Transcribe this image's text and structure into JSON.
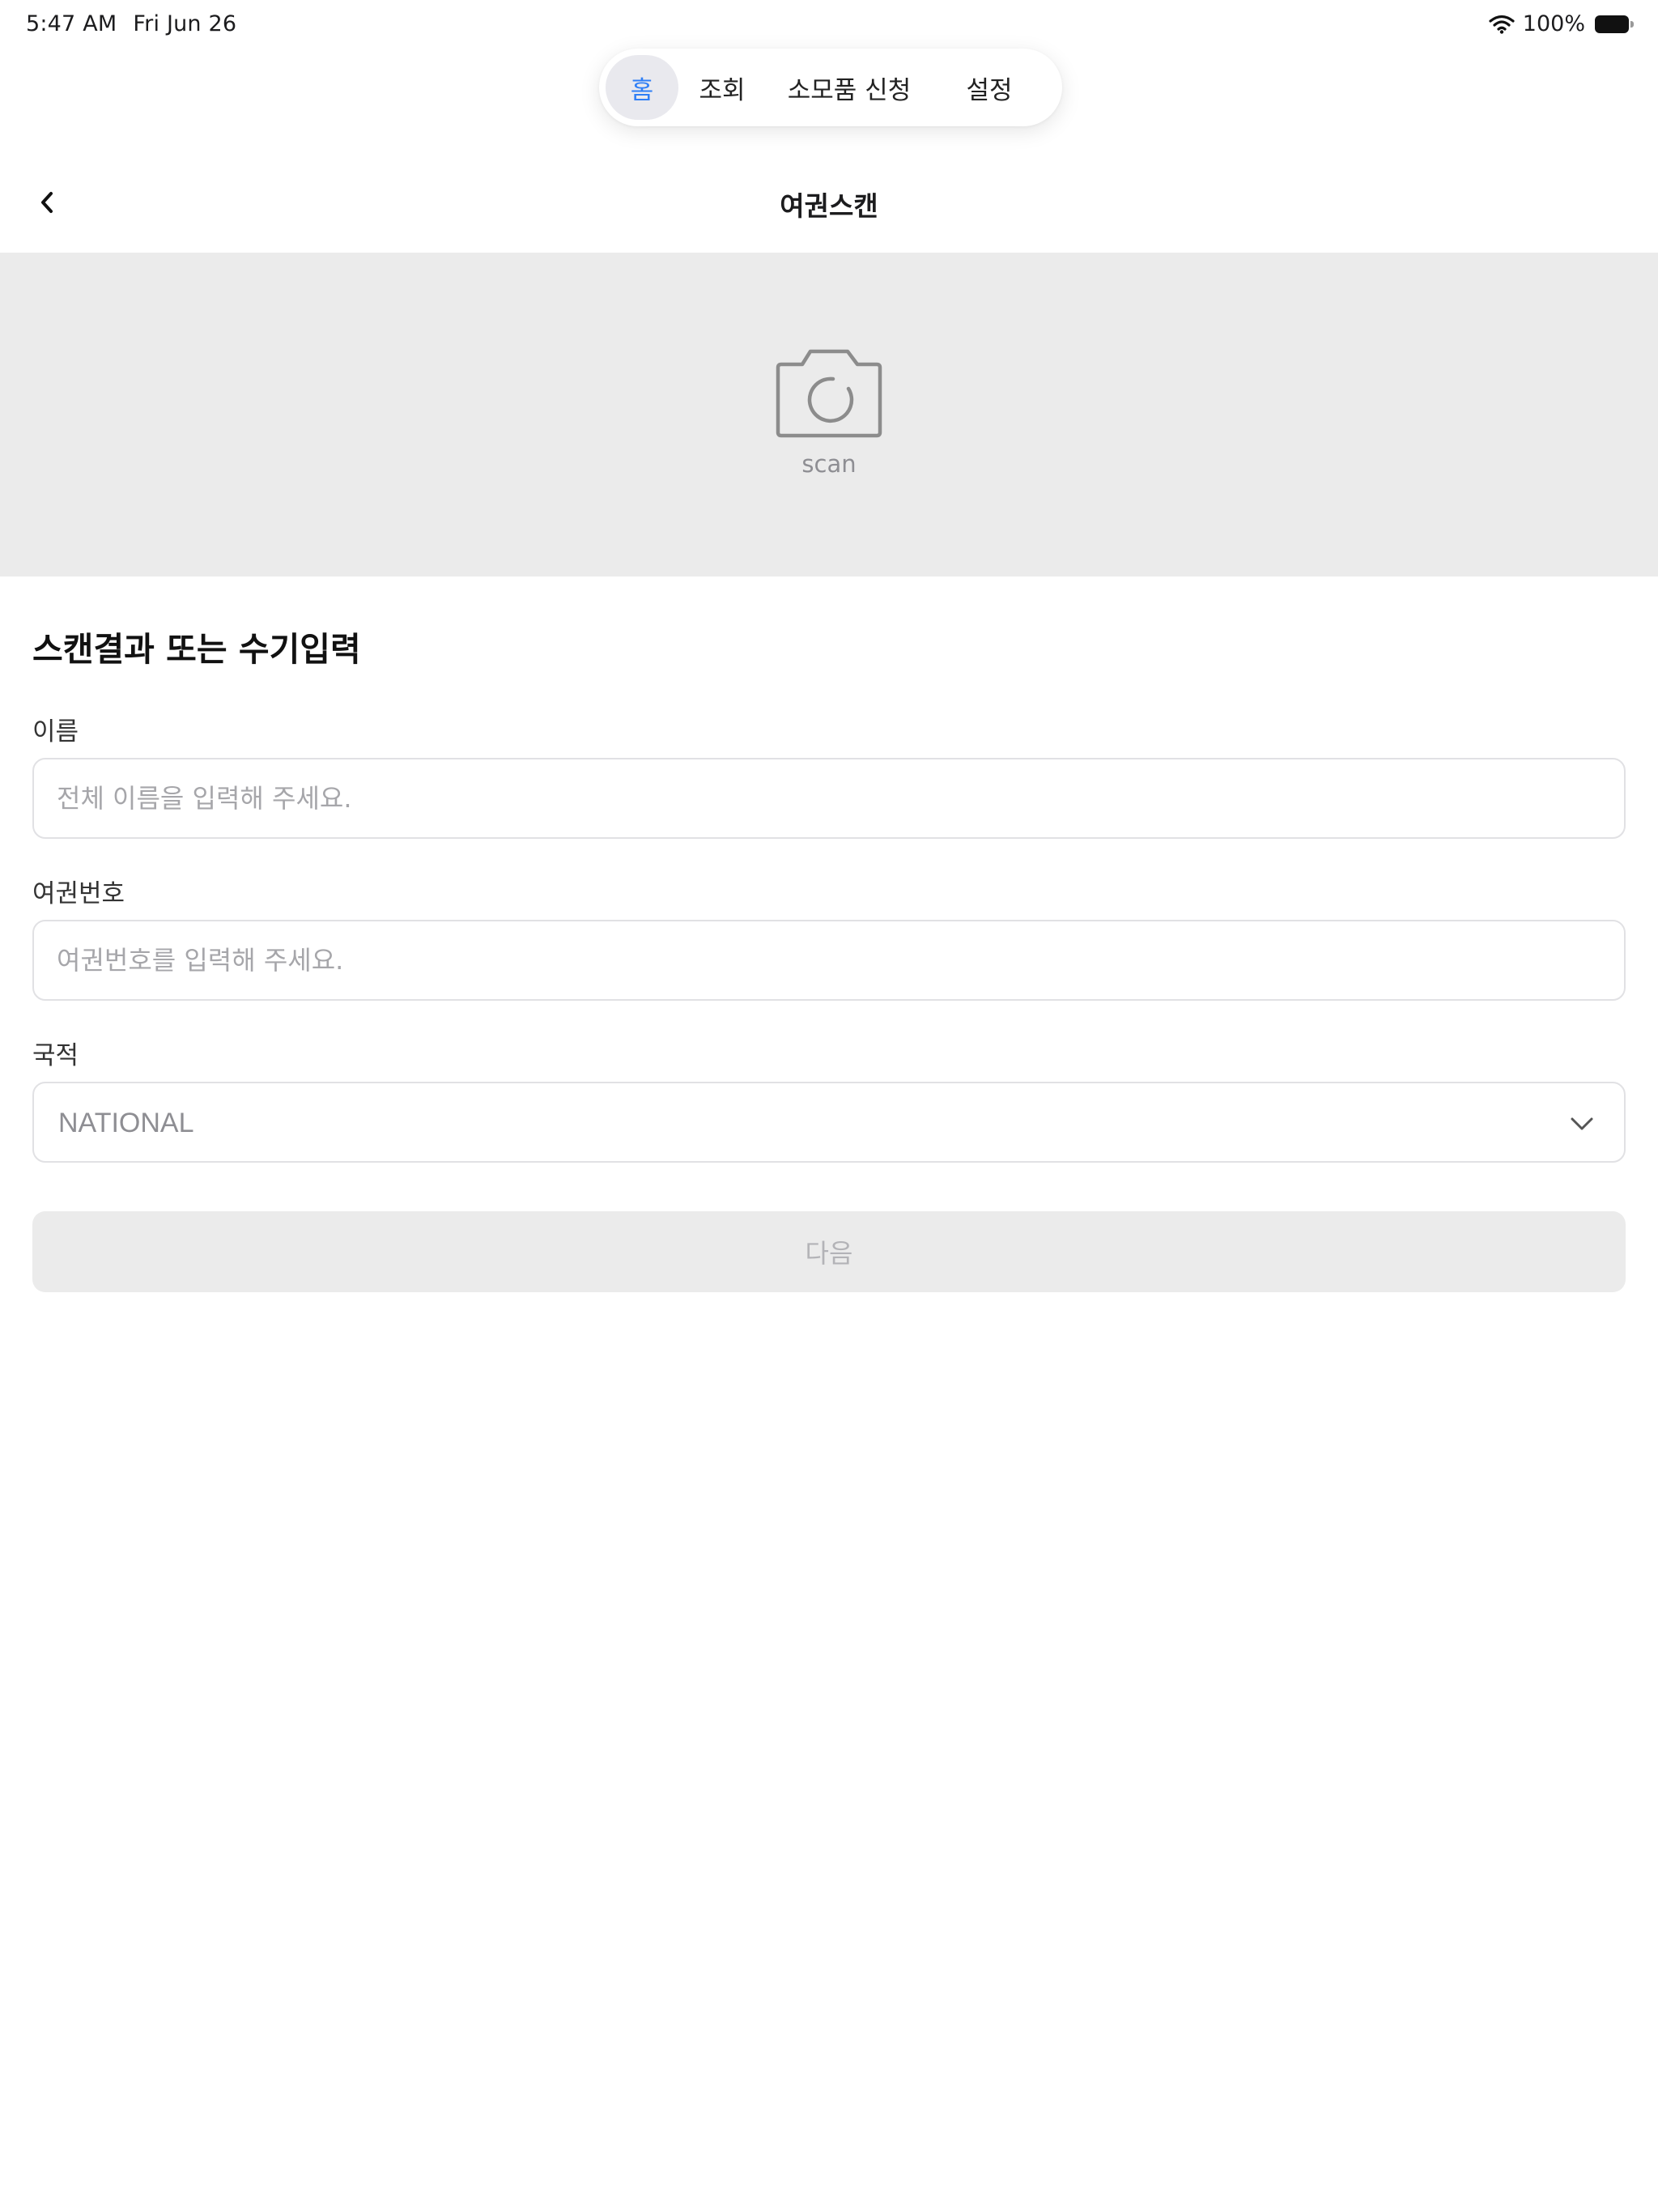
{
  "status_bar": {
    "time": "5:47 AM",
    "date": "Fri Jun 26",
    "battery": "100%",
    "wifi_icon": "wifi-icon",
    "battery_icon": "battery-icon"
  },
  "tabs": [
    {
      "label": "홈",
      "active": true
    },
    {
      "label": "조회",
      "active": false
    },
    {
      "label": "소모품 신청",
      "active": false
    },
    {
      "label": "설정",
      "active": false
    }
  ],
  "header": {
    "title": "여권스캔",
    "back_icon": "chevron-left-icon"
  },
  "scan": {
    "icon": "camera-icon",
    "label": "scan"
  },
  "form": {
    "section_title": "스캔결과 또는 수기입력",
    "name": {
      "label": "이름",
      "placeholder": "전체 이름을 입력해 주세요.",
      "value": ""
    },
    "passport": {
      "label": "여권번호",
      "placeholder": "여권번호를 입력해 주세요.",
      "value": ""
    },
    "nationality": {
      "label": "국적",
      "selected": "NATIONAL",
      "icon": "chevron-down-icon"
    },
    "next_label": "다음"
  },
  "colors": {
    "accent": "#2f7ff6",
    "scan_background": "#ebebeb",
    "disabled_button": "#ebebeb",
    "disabled_text": "#b3b3b7",
    "border": "#e1e1e4"
  }
}
